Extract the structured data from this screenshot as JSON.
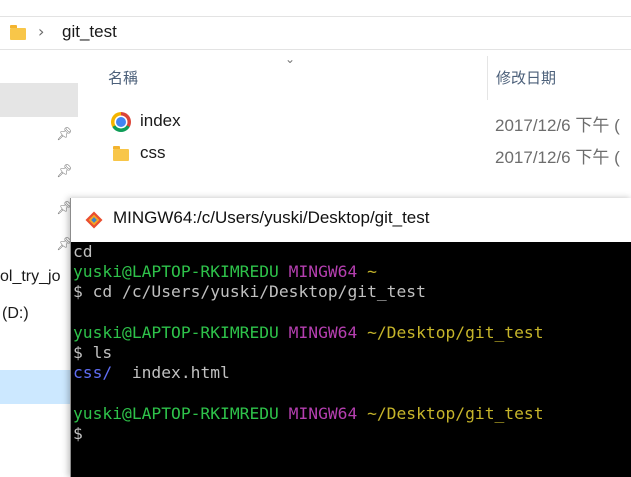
{
  "explorer": {
    "address": {
      "folder_icon": "folder-icon",
      "chevron": "›",
      "path": "git_test"
    },
    "nav": {
      "items": [
        {
          "label": "ol_try_jo"
        },
        {
          "label": "(D:)"
        }
      ],
      "pin_glyph": "📌"
    },
    "columns": {
      "name": "名稱",
      "modified": "修改日期",
      "sort_glyph": "⌄"
    },
    "files": [
      {
        "name": "index",
        "date": "2017/12/6 下午 (",
        "icon": "chrome-icon"
      },
      {
        "name": "css",
        "date": "2017/12/6 下午 (",
        "icon": "folder-icon"
      }
    ]
  },
  "terminal": {
    "title": "MINGW64:/c/Users/yuski/Desktop/git_test",
    "icon": "git-icon",
    "lines": [
      {
        "segments": [
          {
            "text": "cd",
            "cls": "c-text"
          }
        ]
      },
      {
        "segments": [
          {
            "text": "yuski@LAPTOP-RKIMREDU ",
            "cls": "c-user"
          },
          {
            "text": "MINGW64 ",
            "cls": "c-mingw"
          },
          {
            "text": "~",
            "cls": "c-path"
          }
        ]
      },
      {
        "segments": [
          {
            "text": "$ cd /c/Users/yuski/Desktop/git_test",
            "cls": "c-text"
          }
        ]
      },
      {
        "segments": [
          {
            "text": "",
            "cls": "c-text"
          }
        ]
      },
      {
        "segments": [
          {
            "text": "yuski@LAPTOP-RKIMREDU ",
            "cls": "c-user"
          },
          {
            "text": "MINGW64 ",
            "cls": "c-mingw"
          },
          {
            "text": "~/Desktop/git_test",
            "cls": "c-path"
          }
        ]
      },
      {
        "segments": [
          {
            "text": "$ ls",
            "cls": "c-text"
          }
        ]
      },
      {
        "segments": [
          {
            "text": "css/",
            "cls": "c-dir"
          },
          {
            "text": "  index.html",
            "cls": "c-text"
          }
        ]
      },
      {
        "segments": [
          {
            "text": "",
            "cls": "c-text"
          }
        ]
      },
      {
        "segments": [
          {
            "text": "yuski@LAPTOP-RKIMREDU ",
            "cls": "c-user"
          },
          {
            "text": "MINGW64 ",
            "cls": "c-mingw"
          },
          {
            "text": "~/Desktop/git_test",
            "cls": "c-path"
          }
        ]
      },
      {
        "segments": [
          {
            "text": "$",
            "cls": "c-text"
          }
        ]
      }
    ],
    "colors": {
      "background": "#000000",
      "user": "#2ec24a",
      "mingw": "#b53fb0",
      "path": "#c6b52a",
      "dir": "#5f6df2"
    }
  }
}
